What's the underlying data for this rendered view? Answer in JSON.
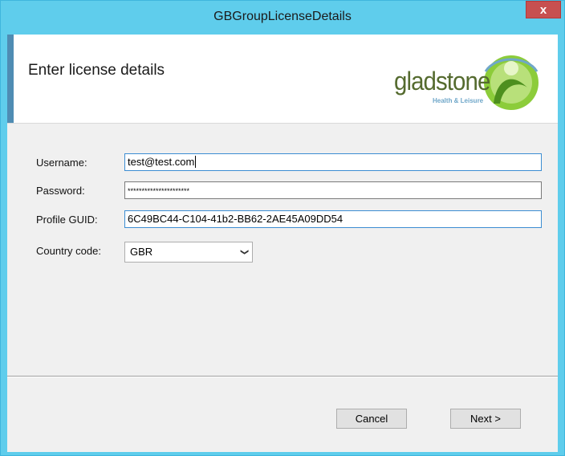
{
  "window": {
    "title": "GBGroupLicenseDetails",
    "close_label": "x"
  },
  "banner": {
    "heading": "Enter license details",
    "logo": {
      "word": "gladstone",
      "tagline": "Health & Leisure",
      "brand_green": "#7fbf2a",
      "brand_blue": "#6fa7c9"
    }
  },
  "form": {
    "username_label": "Username:",
    "username_value": "test@test.com",
    "password_label": "Password:",
    "password_mask": "**********************",
    "guid_label": "Profile GUID:",
    "guid_value": "6C49BC44-C104-41b2-BB62-2AE45A09DD54",
    "country_label": "Country code:",
    "country_value": "GBR"
  },
  "buttons": {
    "cancel": "Cancel",
    "next": "Next >"
  },
  "colors": {
    "titlebar": "#5fcdec",
    "close": "#c75050",
    "banner_accent": "#4f8cb3"
  }
}
